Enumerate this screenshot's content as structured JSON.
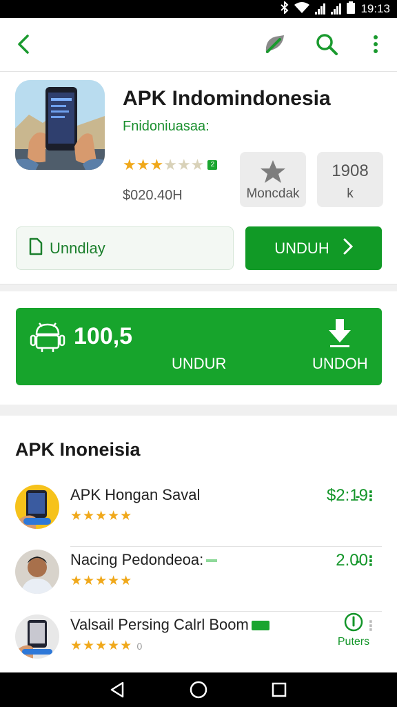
{
  "status_bar": {
    "time": "19:13",
    "icons": [
      "bluetooth-icon",
      "wifi-icon",
      "signal-icon",
      "signal-icon",
      "battery-icon"
    ]
  },
  "app_bar": {
    "icons": [
      "back-icon",
      "leaf-icon",
      "search-icon",
      "more-vert-icon"
    ],
    "accent": "#1a9a2e"
  },
  "app": {
    "title": "APK Indomindonesia",
    "developer": "Fnidoniuasaa:",
    "rating": 3,
    "rating_max": 6,
    "price": "$020.40H",
    "stat1_label": "Moncdak",
    "stat2_value": "1908",
    "stat2_unit": "k",
    "secondary_button": "Unndlay",
    "download_button": "UNDUH",
    "download_chevron": "›"
  },
  "promo": {
    "value": "100,5",
    "label1": "UNDUR",
    "label2": "UNDOH",
    "color": "#17a42c"
  },
  "list": {
    "title": "APK Inoneisia",
    "items": [
      {
        "name": "APK Hongan Saval",
        "stars": "★★★★★",
        "value": "$2:19",
        "more": "- ⋮"
      },
      {
        "name": "Nacing Pedondeoa:",
        "stars": "★★★★★",
        "value": "2.00",
        "more": "- ⋮"
      },
      {
        "name": "Valsail Persing Calrl Boom",
        "stars": "★★★★★",
        "stars_extra": "0",
        "value": "Puters",
        "more": "⋮"
      }
    ]
  },
  "nav_bar": {
    "icons": [
      "back-triangle-icon",
      "home-circle-icon",
      "recents-square-icon"
    ]
  }
}
